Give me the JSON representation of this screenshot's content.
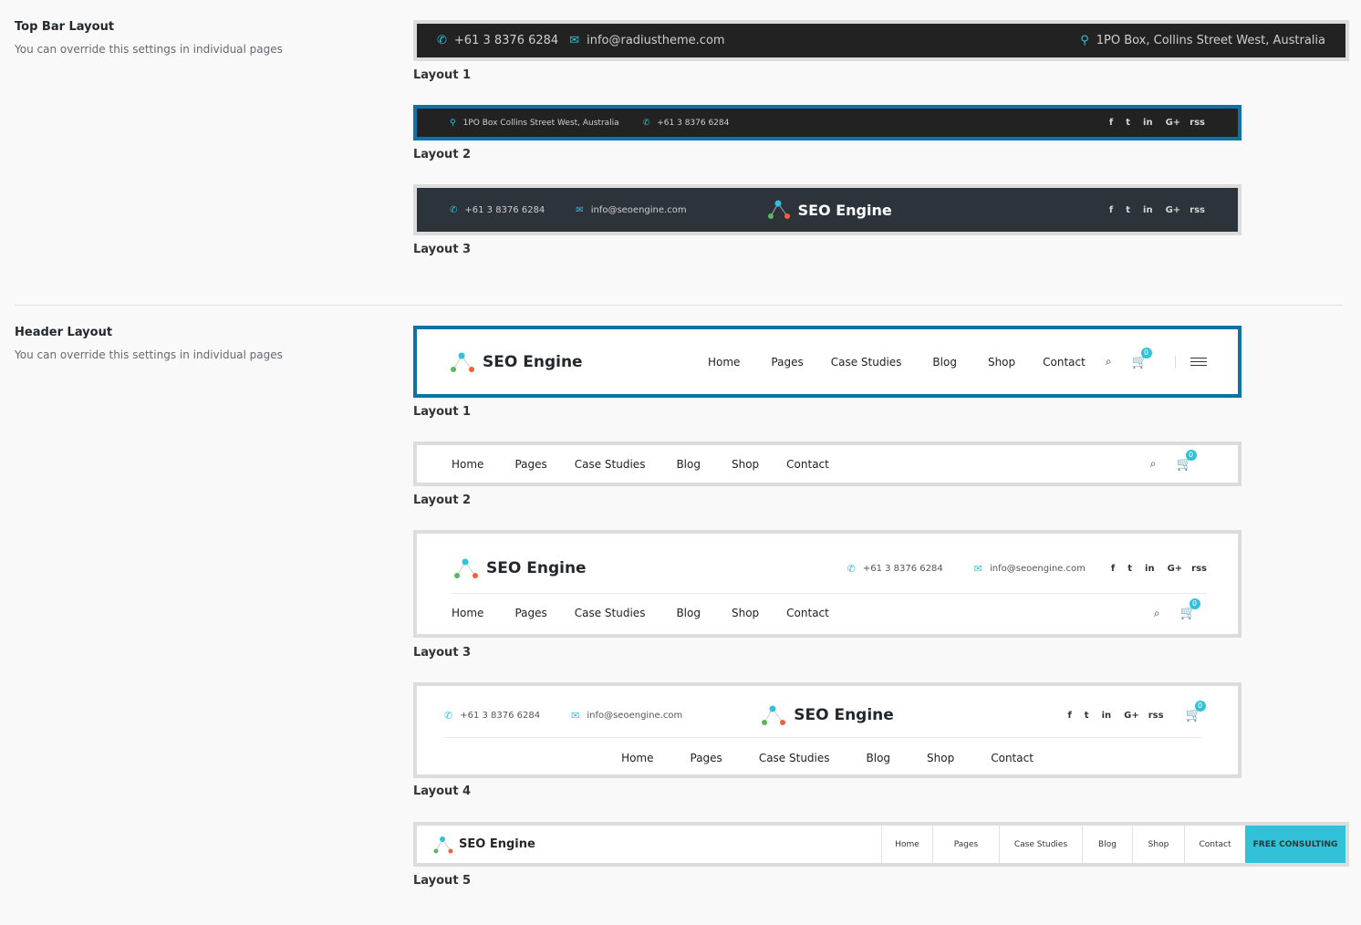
{
  "topbar_section": {
    "title": "Top Bar Layout",
    "desc": "You can override this settings in individual pages",
    "layouts": [
      {
        "label": "Layout 1",
        "phone": "+61 3 8376 6284",
        "email": "info@radiustheme.com",
        "address": "1PO Box, Collins Street West, Australia",
        "selected": false
      },
      {
        "label": "Layout 2",
        "address": "1PO Box  Collins Street West, Australia",
        "phone": "+61 3 8376 6284",
        "selected": true
      },
      {
        "label": "Layout 3",
        "phone": "+61 3 8376 6284",
        "email": "info@seoengine.com",
        "brand": "SEO Engine",
        "selected": false
      }
    ]
  },
  "header_section": {
    "title": "Header Layout",
    "desc": "You can override this settings in individual pages",
    "brand": "SEO Engine",
    "phone": "+61 3 8376 6284",
    "email": "info@seoengine.com",
    "cart_count": "0",
    "nav": [
      "Home",
      "Pages",
      "Case Studies",
      "Blog",
      "Shop",
      "Contact"
    ],
    "cta": "FREE CONSULTING",
    "labels": [
      "Layout 1",
      "Layout 2",
      "Layout 3",
      "Layout 4",
      "Layout 5"
    ]
  },
  "social": [
    "f",
    "t",
    "in",
    "G+",
    "rss"
  ],
  "colors": {
    "accent": "#31c1d9",
    "selected_border": "#0e72a8",
    "dark_bar": "#222222",
    "dark_bar_alt": "#2c333b"
  }
}
